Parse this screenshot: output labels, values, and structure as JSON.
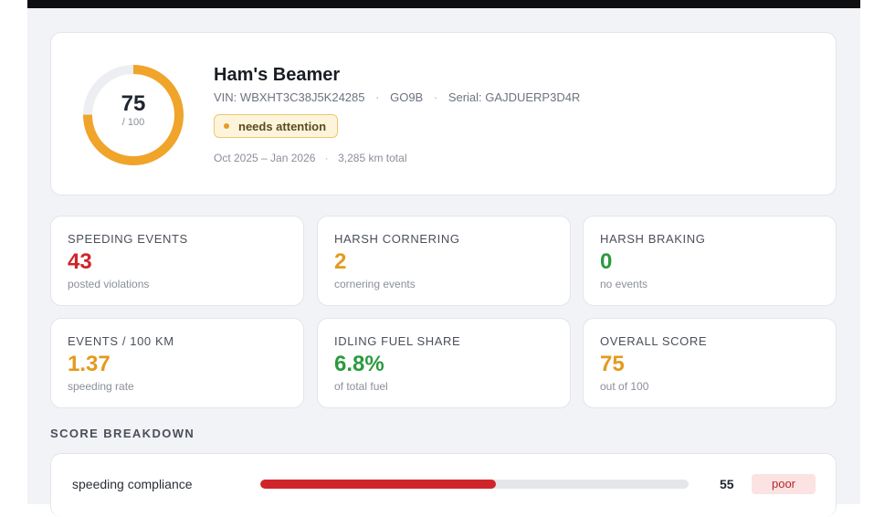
{
  "vehicle": {
    "name": "Ham's Beamer",
    "vin_label": "VIN:",
    "vin": "WBXHT3C38J5K24285",
    "code": "GO9B",
    "serial_label": "Serial:",
    "serial": "GAJDUERP3D4R",
    "status": "needs attention",
    "period": "Oct 2025 – Jan 2026",
    "distance": "3,285 km total"
  },
  "score": {
    "value": "75",
    "max_label": "/ 100",
    "fraction": 0.75
  },
  "metrics": [
    {
      "label": "SPEEDING EVENTS",
      "value": "43",
      "sub": "posted violations",
      "color": "#d0242b"
    },
    {
      "label": "HARSH CORNERING",
      "value": "2",
      "sub": "cornering events",
      "color": "#e49a1e"
    },
    {
      "label": "HARSH BRAKING",
      "value": "0",
      "sub": "no events",
      "color": "#2b9a3e"
    },
    {
      "label": "EVENTS / 100 KM",
      "value": "1.37",
      "sub": "speeding rate",
      "color": "#e49a1e"
    },
    {
      "label": "IDLING FUEL SHARE",
      "value": "6.8%",
      "sub": "of total fuel",
      "color": "#2b9a3e"
    },
    {
      "label": "OVERALL SCORE",
      "value": "75",
      "sub": "out of 100",
      "color": "#e49a1e"
    }
  ],
  "breakdown": {
    "title": "SCORE BREAKDOWN",
    "rows": [
      {
        "label": "speeding compliance",
        "value": "55",
        "fraction": 0.55,
        "rating": "poor",
        "color": "#d0242b"
      }
    ]
  },
  "colors": {
    "accent_amber": "#f0a42a",
    "ring_track": "#eceef1",
    "status_badge_bg": "#fdf4dc",
    "poor_badge_bg": "#fbe3e3"
  }
}
